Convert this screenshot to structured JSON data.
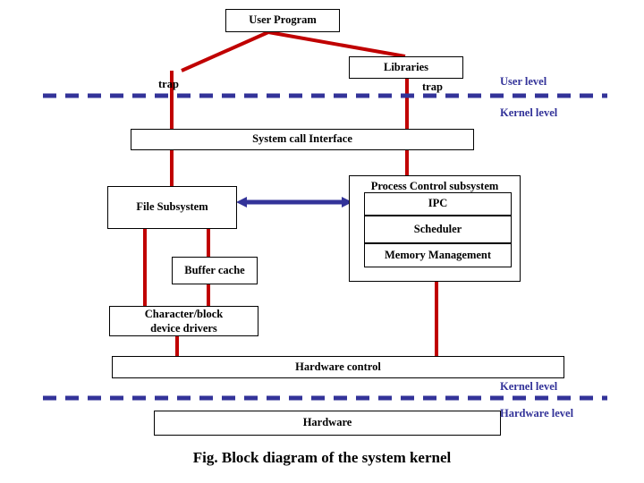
{
  "figure": {
    "caption": "Fig. Block diagram of the system kernel",
    "colors": {
      "connector_red": "#C00000",
      "divider_blue": "#333399",
      "arrow_blue": "#333399",
      "box_border": "#000000",
      "background": "#FFFFFF",
      "text": "#000000"
    }
  },
  "boxes": {
    "user_program": "User Program",
    "libraries": "Libraries",
    "system_call_interface": "System call Interface",
    "file_subsystem": "File Subsystem",
    "process_control_subsystem": "Process Control subsystem",
    "ipc": "IPC",
    "scheduler": "Scheduler",
    "memory_management": "Memory Management",
    "buffer_cache": "Buffer cache",
    "device_drivers_line1": "Character/block",
    "device_drivers_line2": "device drivers",
    "hardware_control": "Hardware control",
    "hardware": "Hardware"
  },
  "labels": {
    "trap_left": "trap",
    "trap_right": "trap"
  },
  "levels": {
    "user_level": "User level",
    "kernel_level_top": "Kernel level",
    "kernel_level_bottom": "Kernel level",
    "hardware_level": "Hardware level"
  }
}
